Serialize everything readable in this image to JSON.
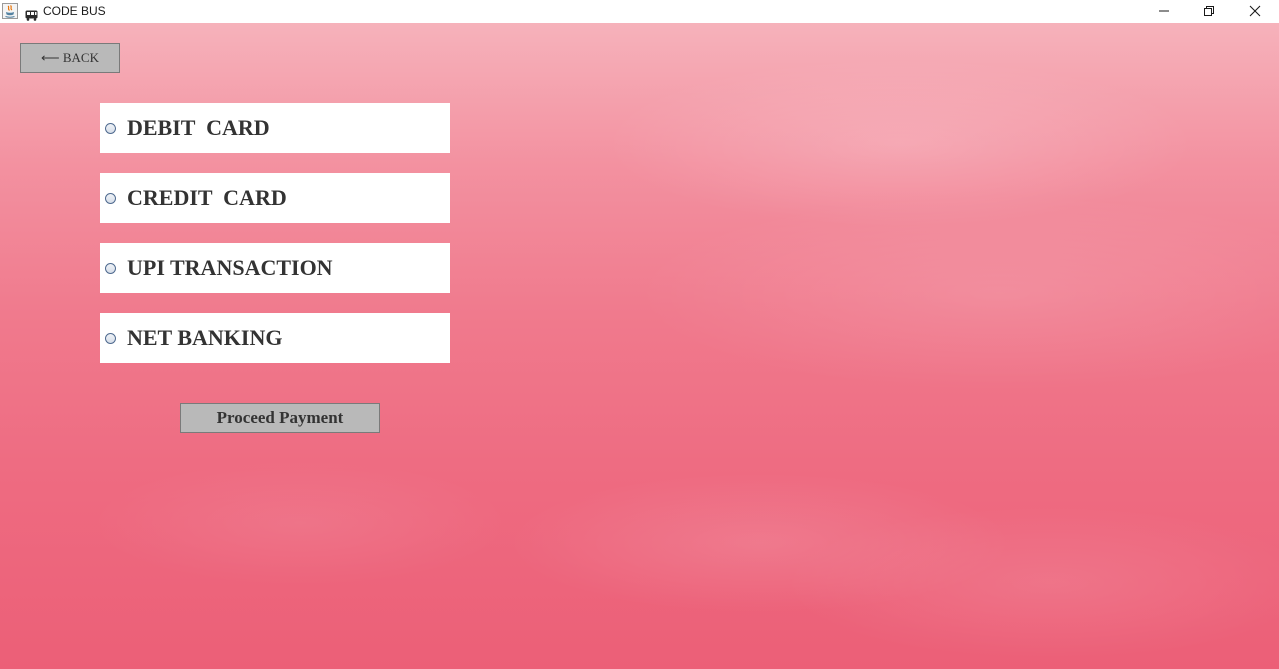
{
  "window": {
    "title": "CODE BUS",
    "app_icon": "java-icon",
    "title_icon": "bus-icon",
    "controls": [
      "minimize-icon",
      "maximize-icon",
      "close-icon"
    ]
  },
  "back_button": {
    "label": "⟵ BACK"
  },
  "payment_options": [
    {
      "label": "DEBIT  CARD",
      "selected": false
    },
    {
      "label": "CREDIT  CARD",
      "selected": false
    },
    {
      "label": "UPI TRANSACTION",
      "selected": false
    },
    {
      "label": "NET BANKING",
      "selected": false
    }
  ],
  "proceed_button": {
    "label": "Proceed Payment"
  },
  "colors": {
    "background_top": "#f6b2bb",
    "background_bottom": "#ec5f77",
    "button_gray": "#b9b9b9",
    "text_dark": "#333333"
  }
}
